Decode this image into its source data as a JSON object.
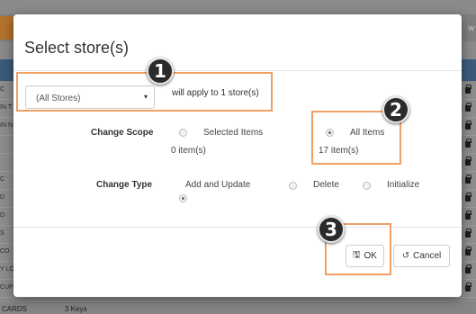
{
  "background": {
    "header_right": "w",
    "rows": [
      {
        "text": "C"
      },
      {
        "text": "IN T"
      },
      {
        "text": "IN N"
      },
      {
        "text": ""
      },
      {
        "text": ""
      },
      {
        "text": "C"
      },
      {
        "text": "D"
      },
      {
        "text": "D"
      },
      {
        "text": "S"
      },
      {
        "text": "CO"
      },
      {
        "text": "Y LO"
      },
      {
        "text": "CUP"
      }
    ],
    "bottom_row": {
      "name": "CARDS",
      "value": "3 Keys"
    }
  },
  "modal": {
    "title": "Select store(s)",
    "store_select": {
      "value": "(All Stores)",
      "caret": "▾"
    },
    "apply_text": "will apply to 1 store(s)",
    "change_scope": {
      "label": "Change Scope",
      "options": [
        {
          "label": "Selected Items",
          "count": "0 item(s)",
          "checked": false
        },
        {
          "label": "All Items",
          "count": "17 item(s)",
          "checked": true
        }
      ]
    },
    "change_type": {
      "label": "Change Type",
      "options": [
        {
          "label": "Add and Update",
          "checked": true
        },
        {
          "label": "Delete",
          "checked": false
        },
        {
          "label": "Initialize",
          "checked": false
        }
      ]
    },
    "buttons": {
      "ok": {
        "label": "OK",
        "icon": "save-icon"
      },
      "cancel": {
        "label": "Cancel",
        "icon": "undo-icon"
      }
    }
  },
  "callouts": [
    "1",
    "2",
    "3"
  ],
  "colors": {
    "highlight": "#f0a064",
    "callout_bg": "#2b2b2b",
    "header_bar": "#3b5b7a",
    "logo": "#b5722a"
  }
}
